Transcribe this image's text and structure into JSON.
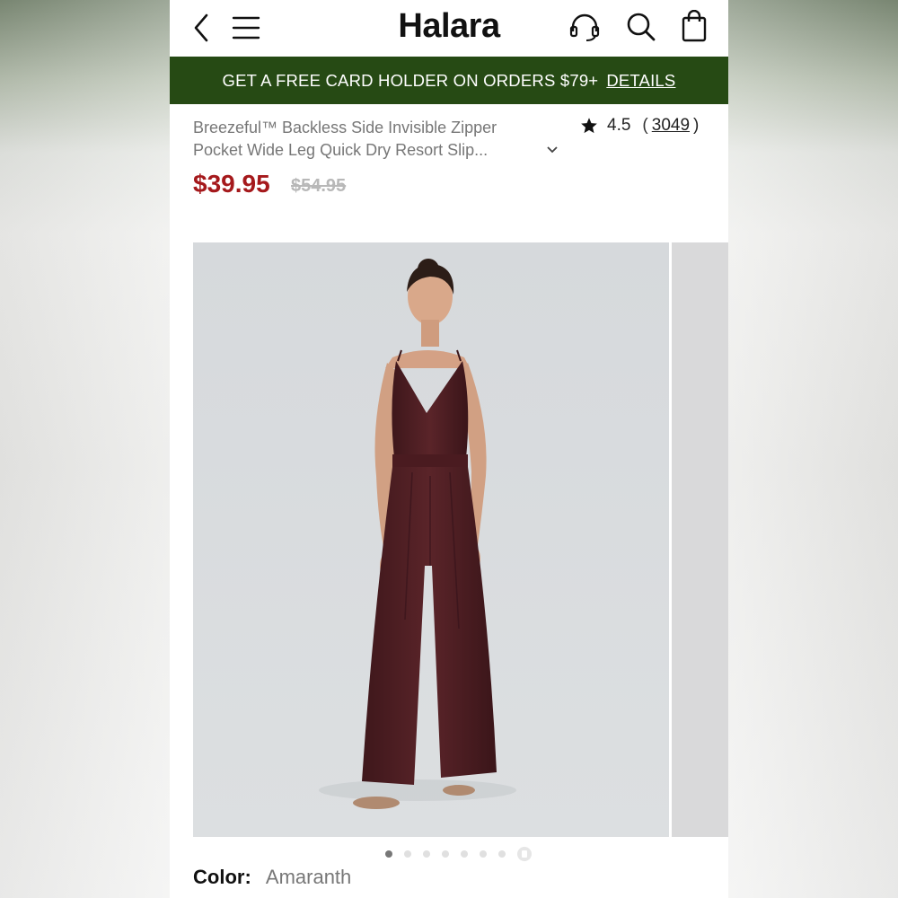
{
  "header": {
    "brand": "Halara",
    "icons": [
      "back-arrow-icon",
      "menu-icon",
      "headset-icon",
      "search-icon",
      "shopping-bag-icon"
    ]
  },
  "promo_banner": {
    "text": "GET A FREE CARD HOLDER ON ORDERS $79+",
    "link": "DETAILS",
    "color": "#264a14"
  },
  "product": {
    "title_line1": "Breezeful™ Backless Side Invisible Zipper",
    "title_line2": "Pocket Wide Leg Quick Dry Resort Slip...",
    "rating": "4.5",
    "review_paren_open": "(",
    "review_count": "3049",
    "review_paren_close": ")",
    "price": "$39.95",
    "original_price": "$54.95",
    "price_color": "#a5191c"
  },
  "gallery": {
    "slide_count": 8,
    "active_index": 0,
    "last_is_video": true
  },
  "color_option": {
    "label": "Color:",
    "value": "Amaranth",
    "swatch": "#4a1e22"
  }
}
